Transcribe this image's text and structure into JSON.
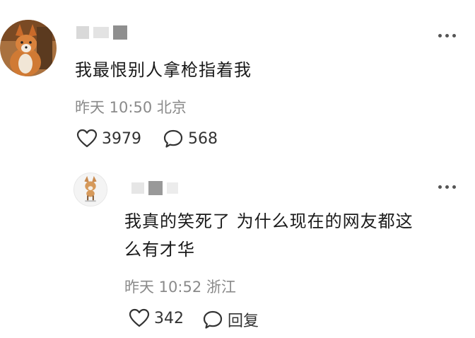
{
  "comment": {
    "text": "我最恨别人拿枪指着我",
    "time": "昨天 10:50",
    "location": "北京",
    "likes": "3979",
    "replies": "568",
    "icons": {
      "avatar": "fox-avatar-icon",
      "like": "heart-icon",
      "reply": "speech-bubble-icon",
      "more": "more-dots-icon"
    }
  },
  "reply": {
    "text_line1": "我真的笑死了 为什么现在的网友都这",
    "text_line2": "么有才华",
    "time": "昨天 10:52",
    "location": "浙江",
    "likes": "342",
    "reply_label": "回复",
    "icons": {
      "avatar": "dog-avatar-icon",
      "like": "heart-icon",
      "reply": "speech-bubble-icon",
      "more": "more-dots-icon"
    }
  },
  "colors": {
    "text": "#1a1a1a",
    "meta": "#8a8a8a",
    "blur": "#d9d9d9"
  }
}
